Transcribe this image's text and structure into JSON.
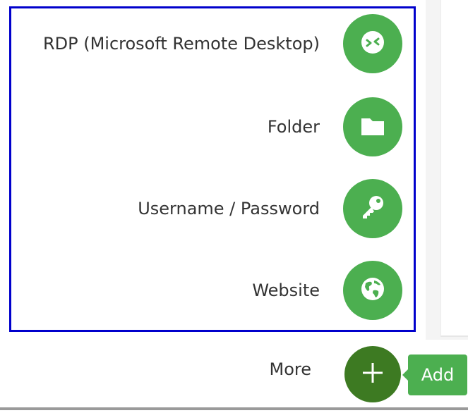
{
  "menu": {
    "items": [
      {
        "label": "RDP (Microsoft Remote Desktop)",
        "icon": "rdp-icon"
      },
      {
        "label": "Folder",
        "icon": "folder-icon"
      },
      {
        "label": "Username / Password",
        "icon": "key-icon"
      },
      {
        "label": "Website",
        "icon": "globe-icon"
      }
    ]
  },
  "fab": {
    "more_label": "More",
    "add_tooltip": "Add",
    "icon": "plus-icon"
  },
  "colors": {
    "accent": "#4caf50",
    "fab_main": "#3d7a22",
    "highlight_border": "#0000cc"
  }
}
